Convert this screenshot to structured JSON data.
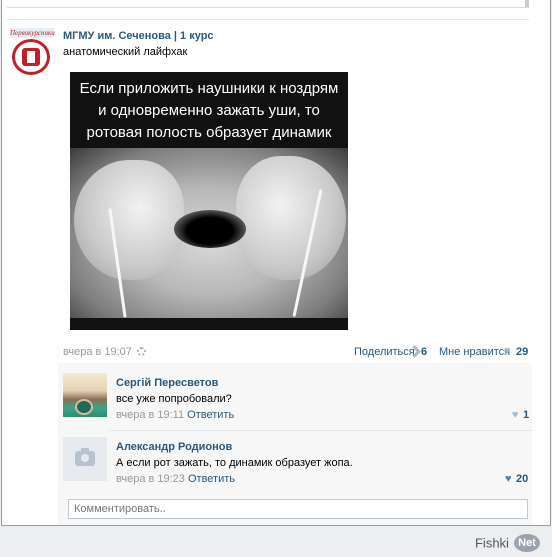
{
  "post": {
    "group_name": "МГМУ им. Сеченова | 1 курс",
    "text": "анатомический лайфхак",
    "logo_caption": "Первокурсники",
    "image_caption": [
      "Если приложить наушники к ноздрям",
      "и одновременно зажать уши, то",
      "ротовая полость образует динамик"
    ],
    "timestamp": "вчера в 19:07",
    "share_label": "Поделиться",
    "share_count": "6",
    "like_label": "Мне нравится",
    "like_count": "29"
  },
  "comments": [
    {
      "author": "Сергiй Пересветов",
      "text": "все уже попробовали?",
      "timestamp": "вчера в 19:11",
      "reply_label": "Ответить",
      "likes": "1"
    },
    {
      "author": "Александр Родионов",
      "text": "А если рот зажать, то динамик образует жопа.",
      "timestamp": "вчера в 19:23",
      "reply_label": "Ответить",
      "likes": "20"
    }
  ],
  "reply": {
    "placeholder": "Комментировать.."
  },
  "watermark": {
    "text": "Fishki",
    "badge": "Net"
  },
  "icons": {
    "heart": "♥"
  }
}
